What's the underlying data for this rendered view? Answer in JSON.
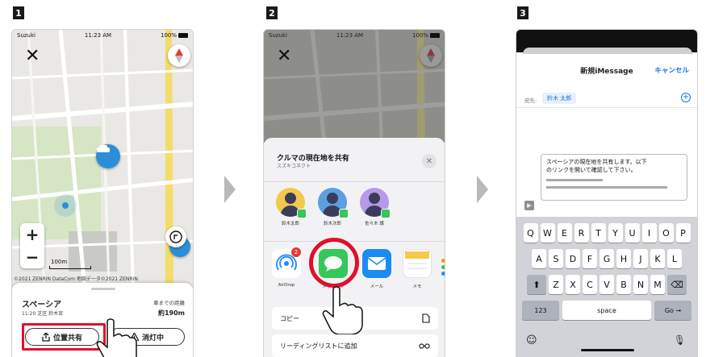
{
  "steps": [
    "1",
    "2",
    "3"
  ],
  "phone1": {
    "status": {
      "carrier": "Suzuki",
      "time": "11:23 AM",
      "battery": "100%"
    },
    "map": {
      "scale": "100m",
      "copyright": "©2021 ZENRIN DataCom 地図データ©2021 ZENRIN"
    },
    "sheet": {
      "name": "スペーシア",
      "address": "11:20 芝区 鈴木宮",
      "distance_label": "車までの距離",
      "distance": "約190m",
      "share_button": "位置共有",
      "light_button": "消灯中"
    }
  },
  "phone2": {
    "status": {
      "carrier": "Suzuki",
      "time": "11:23 AM",
      "battery": "100%"
    },
    "share": {
      "title": "クルマの現在地を共有",
      "subtitle": "スズキコネクト",
      "contacts": [
        {
          "name": "鈴木太郎",
          "color": "#f2c94c"
        },
        {
          "name": "鈴木次郎",
          "color": "#5aa0e0"
        },
        {
          "name": "佐々木 譲",
          "color": "#b69ae8"
        }
      ],
      "apps": [
        {
          "label": "AirDrop",
          "badge": "2"
        },
        {
          "label": "メッセージ"
        },
        {
          "label": "メール"
        },
        {
          "label": "メモ"
        }
      ],
      "actions": [
        "コピー",
        "リーディングリストに追加"
      ]
    }
  },
  "phone3": {
    "title": "新規iMessage",
    "cancel": "キャンセル",
    "to_label": "宛先:",
    "recipient": "鈴木 太郎",
    "message_line1": "スペーシアの現在地を共有します。以下",
    "message_line2": "のリンクを開いて確認して下さい。",
    "keyboard": {
      "row1": [
        "Q",
        "W",
        "E",
        "R",
        "T",
        "Y",
        "U",
        "I",
        "O",
        "P"
      ],
      "row2": [
        "A",
        "S",
        "D",
        "F",
        "G",
        "H",
        "J",
        "K",
        "L"
      ],
      "row3": [
        "Z",
        "X",
        "C",
        "V",
        "B",
        "N",
        "M"
      ],
      "num": "123",
      "space": "space",
      "go": "Go"
    }
  },
  "colors": {
    "highlight": "#e0102c",
    "ios_blue": "#1a73e8",
    "messages_green": "#34c759",
    "car_pin": "#2a8fd8"
  }
}
